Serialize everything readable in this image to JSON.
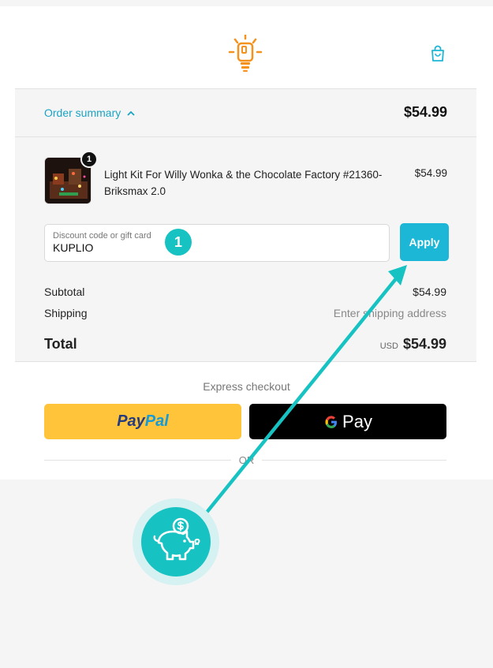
{
  "header": {
    "logo_icon": "lightbulb-brick-icon",
    "cart_icon": "shopping-bag-icon",
    "colors": {
      "logo": "#f5921e",
      "accent": "#1cb7d6"
    }
  },
  "summary": {
    "toggle_label": "Order summary",
    "toggle_icon": "chevron-up-icon",
    "total": "$54.99"
  },
  "item": {
    "quantity": "1",
    "name": "Light Kit For Willy Wonka & the Chocolate Factory #21360-Briksmax 2.0",
    "price": "$54.99"
  },
  "discount": {
    "label": "Discount code or gift card",
    "value": "KUPLIO",
    "step_badge": "1",
    "apply_label": "Apply"
  },
  "totals": {
    "subtotal_label": "Subtotal",
    "subtotal_value": "$54.99",
    "shipping_label": "Shipping",
    "shipping_value": "Enter shipping address",
    "total_label": "Total",
    "currency": "USD",
    "total_value": "$54.99"
  },
  "express": {
    "label": "Express checkout",
    "paypal_part1": "Pay",
    "paypal_part2": "Pal",
    "gpay_g": "G",
    "gpay_label": "Pay",
    "or_label": "OR"
  },
  "overlay": {
    "piggy_icon": "piggy-bank-icon",
    "accent": "#16c2c2"
  }
}
